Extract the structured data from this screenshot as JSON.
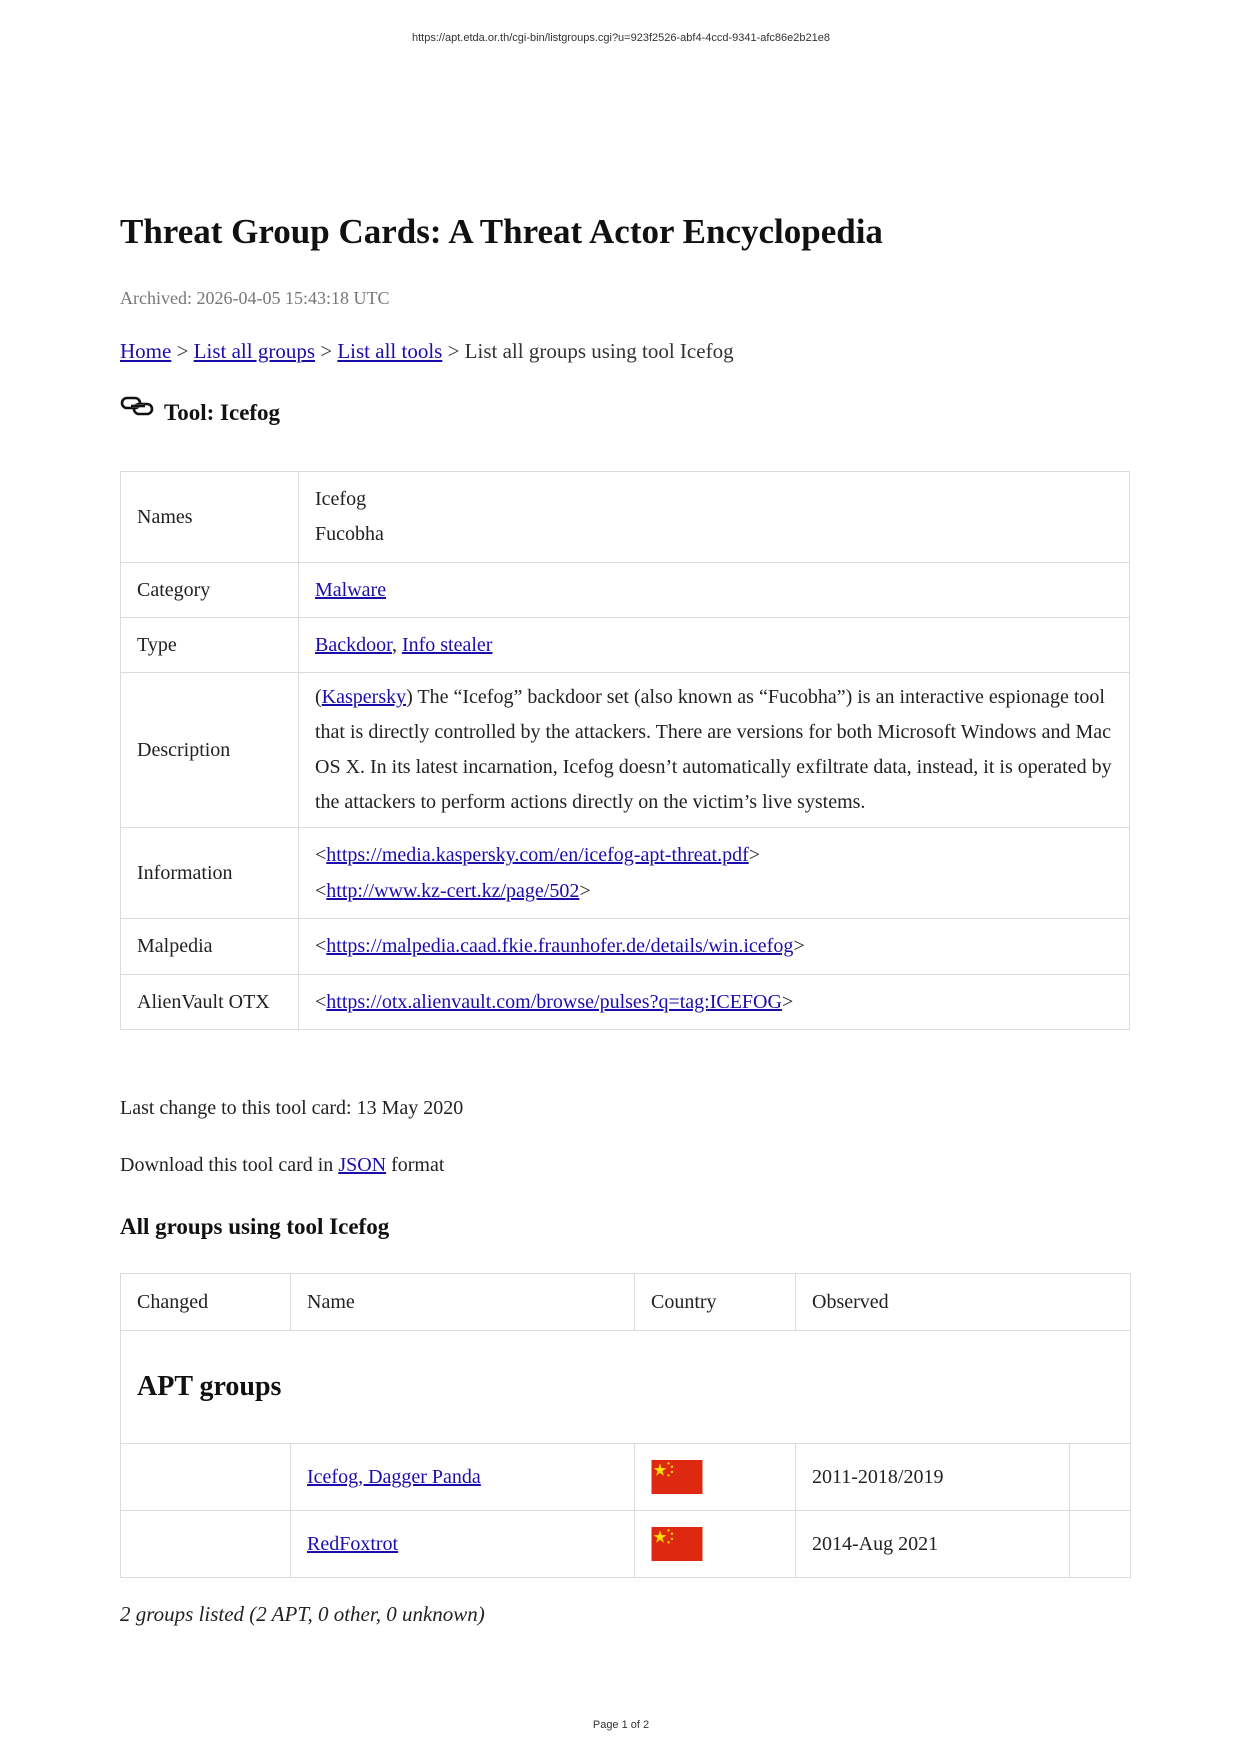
{
  "browser": {
    "url": "https://apt.etda.or.th/cgi-bin/listgroups.cgi?u=923f2526-abf4-4ccd-9341-afc86e2b21e8"
  },
  "page": {
    "title": "Threat Group Cards: A Threat Actor Encyclopedia",
    "archived": "Archived: 2026-04-05 15:43:18 UTC",
    "footer": "Page 1 of 2"
  },
  "breadcrumb": {
    "home": "Home",
    "sep1": " > ",
    "list_groups": "List all groups",
    "sep2": " > ",
    "list_tools": "List all tools",
    "current": " > List all groups using tool Icefog"
  },
  "tool": {
    "heading": "Tool: Icefog",
    "icon": "link-icon",
    "rows": {
      "names": {
        "label": "Names",
        "values": [
          "Icefog",
          "Fucobha"
        ]
      },
      "category": {
        "label": "Category",
        "link": "Malware"
      },
      "type": {
        "label": "Type",
        "link1": "Backdoor",
        "sep": ", ",
        "link2": "Info stealer"
      },
      "description": {
        "label": "Description",
        "open": "(",
        "source": "Kaspersky",
        "text": ") The “Icefog” backdoor set (also known as “Fucobha”) is an interactive espionage tool that is directly controlled by the attackers. There are versions for both Microsoft Windows and Mac OS X. In its latest incarnation, Icefog doesn’t automatically exfiltrate data, instead, it is operated by the attackers to perform actions directly on the victim’s live systems."
      },
      "information": {
        "label": "Information",
        "lt": "<",
        "gt": ">",
        "links": [
          "https://media.kaspersky.com/en/icefog-apt-threat.pdf",
          "http://www.kz-cert.kz/page/502"
        ]
      },
      "malpedia": {
        "label": "Malpedia",
        "lt": "<",
        "gt": ">",
        "link": "https://malpedia.caad.fkie.fraunhofer.de/details/win.icefog"
      },
      "alienvault": {
        "label": "AlienVault OTX",
        "lt": "<",
        "gt": ">",
        "link": "https://otx.alienvault.com/browse/pulses?q=tag:ICEFOG"
      }
    },
    "last_change": "Last change to this tool card: 13 May 2020",
    "download": {
      "before": "Download this tool card in ",
      "link": "JSON",
      "after": " format"
    }
  },
  "groups": {
    "heading": "All groups using tool Icefog",
    "columns": [
      "Changed",
      "Name",
      "Country",
      "Observed"
    ],
    "section": "APT groups",
    "rows": [
      {
        "changed": "",
        "name": "Icefog, Dagger Panda",
        "country_flag": "flag-china-icon",
        "observed": "2011-2018/2019"
      },
      {
        "changed": "",
        "name": "RedFoxtrot",
        "country_flag": "flag-china-icon",
        "observed": "2014-Aug 2021"
      }
    ],
    "summary": "2 groups listed (2 APT, 0 other, 0 unknown)"
  },
  "colors": {
    "link": "#1a0dab",
    "flag_red": "#de2910",
    "flag_yellow": "#ffde00",
    "border": "#dcdcdc"
  }
}
